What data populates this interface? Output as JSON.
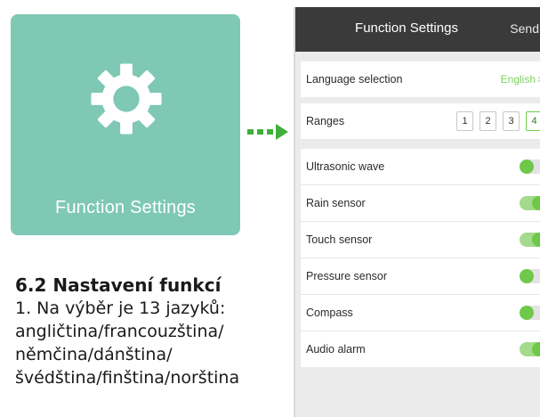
{
  "tile": {
    "label": "Function Settings"
  },
  "caption": {
    "heading": "6.2 Nastavení funkcí",
    "lines": [
      "1. Na výběr je 13 jazyků:",
      "angličtina/francouzština/",
      "němčina/dánština/",
      "švédština/finština/norština"
    ]
  },
  "phone": {
    "nav": {
      "title": "Function Settings",
      "send": "Send"
    },
    "language": {
      "label": "Language selection",
      "value": "English"
    },
    "ranges": {
      "label": "Ranges",
      "options": [
        "1",
        "2",
        "3",
        "4"
      ],
      "selected": "4"
    },
    "toggles": [
      {
        "label": "Ultrasonic wave",
        "on": false
      },
      {
        "label": "Rain sensor",
        "on": true
      },
      {
        "label": "Touch sensor",
        "on": true
      },
      {
        "label": "Pressure sensor",
        "on": false
      },
      {
        "label": "Compass",
        "on": false
      },
      {
        "label": "Audio alarm",
        "on": true
      }
    ]
  },
  "colors": {
    "tile": "#7ec8b4",
    "accent_green": "#6fc84a",
    "nav_bg": "#3a3a3a",
    "arrow": "#3fae3a"
  }
}
